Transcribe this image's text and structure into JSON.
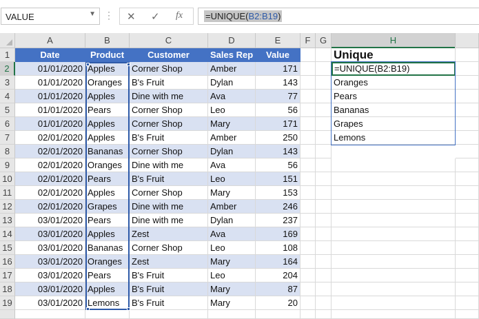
{
  "formula_bar": {
    "name_box": "VALUE",
    "formula_fn": "=UNIQUE(",
    "formula_ref": "B2:B19",
    "formula_close": ")",
    "cancel_icon": "✕",
    "enter_icon": "✓",
    "fx_label": "fx"
  },
  "columns": [
    "A",
    "B",
    "C",
    "D",
    "E",
    "F",
    "G",
    "H"
  ],
  "rows": [
    "1",
    "2",
    "3",
    "4",
    "5",
    "6",
    "7",
    "8",
    "9",
    "10",
    "11",
    "12",
    "13",
    "14",
    "15",
    "16",
    "17",
    "18",
    "19"
  ],
  "table": {
    "headers": [
      "Date",
      "Product",
      "Customer",
      "Sales Rep",
      "Value"
    ],
    "rows": [
      [
        "01/01/2020",
        "Apples",
        "Corner Shop",
        "Amber",
        "171"
      ],
      [
        "01/01/2020",
        "Oranges",
        "B's Fruit",
        "Dylan",
        "143"
      ],
      [
        "01/01/2020",
        "Apples",
        "Dine with me",
        "Ava",
        "77"
      ],
      [
        "01/01/2020",
        "Pears",
        "Corner Shop",
        "Leo",
        "56"
      ],
      [
        "01/01/2020",
        "Apples",
        "Corner Shop",
        "Mary",
        "171"
      ],
      [
        "02/01/2020",
        "Apples",
        "B's Fruit",
        "Amber",
        "250"
      ],
      [
        "02/01/2020",
        "Bananas",
        "Corner Shop",
        "Dylan",
        "143"
      ],
      [
        "02/01/2020",
        "Oranges",
        "Dine with me",
        "Ava",
        "56"
      ],
      [
        "02/01/2020",
        "Pears",
        "B's Fruit",
        "Leo",
        "151"
      ],
      [
        "02/01/2020",
        "Apples",
        "Corner Shop",
        "Mary",
        "153"
      ],
      [
        "02/01/2020",
        "Grapes",
        "Dine with me",
        "Amber",
        "246"
      ],
      [
        "03/01/2020",
        "Pears",
        "Dine with me",
        "Dylan",
        "237"
      ],
      [
        "03/01/2020",
        "Apples",
        "Zest",
        "Ava",
        "169"
      ],
      [
        "03/01/2020",
        "Bananas",
        "Corner Shop",
        "Leo",
        "108"
      ],
      [
        "03/01/2020",
        "Oranges",
        "Zest",
        "Mary",
        "164"
      ],
      [
        "03/01/2020",
        "Pears",
        "B's Fruit",
        "Leo",
        "204"
      ],
      [
        "03/01/2020",
        "Apples",
        "B's Fruit",
        "Mary",
        "87"
      ],
      [
        "03/01/2020",
        "Lemons",
        "B's Fruit",
        "Mary",
        "20"
      ]
    ]
  },
  "unique": {
    "title": "Unique",
    "active_cell_text": "=UNIQUE(B2:B19)",
    "values": [
      "Oranges",
      "Pears",
      "Bananas",
      "Grapes",
      "Lemons"
    ]
  },
  "colors": {
    "header_blue": "#4472c4",
    "band_blue": "#d9e1f2",
    "selection_green": "#217346",
    "range_ref_blue": "#2e5aa8"
  }
}
